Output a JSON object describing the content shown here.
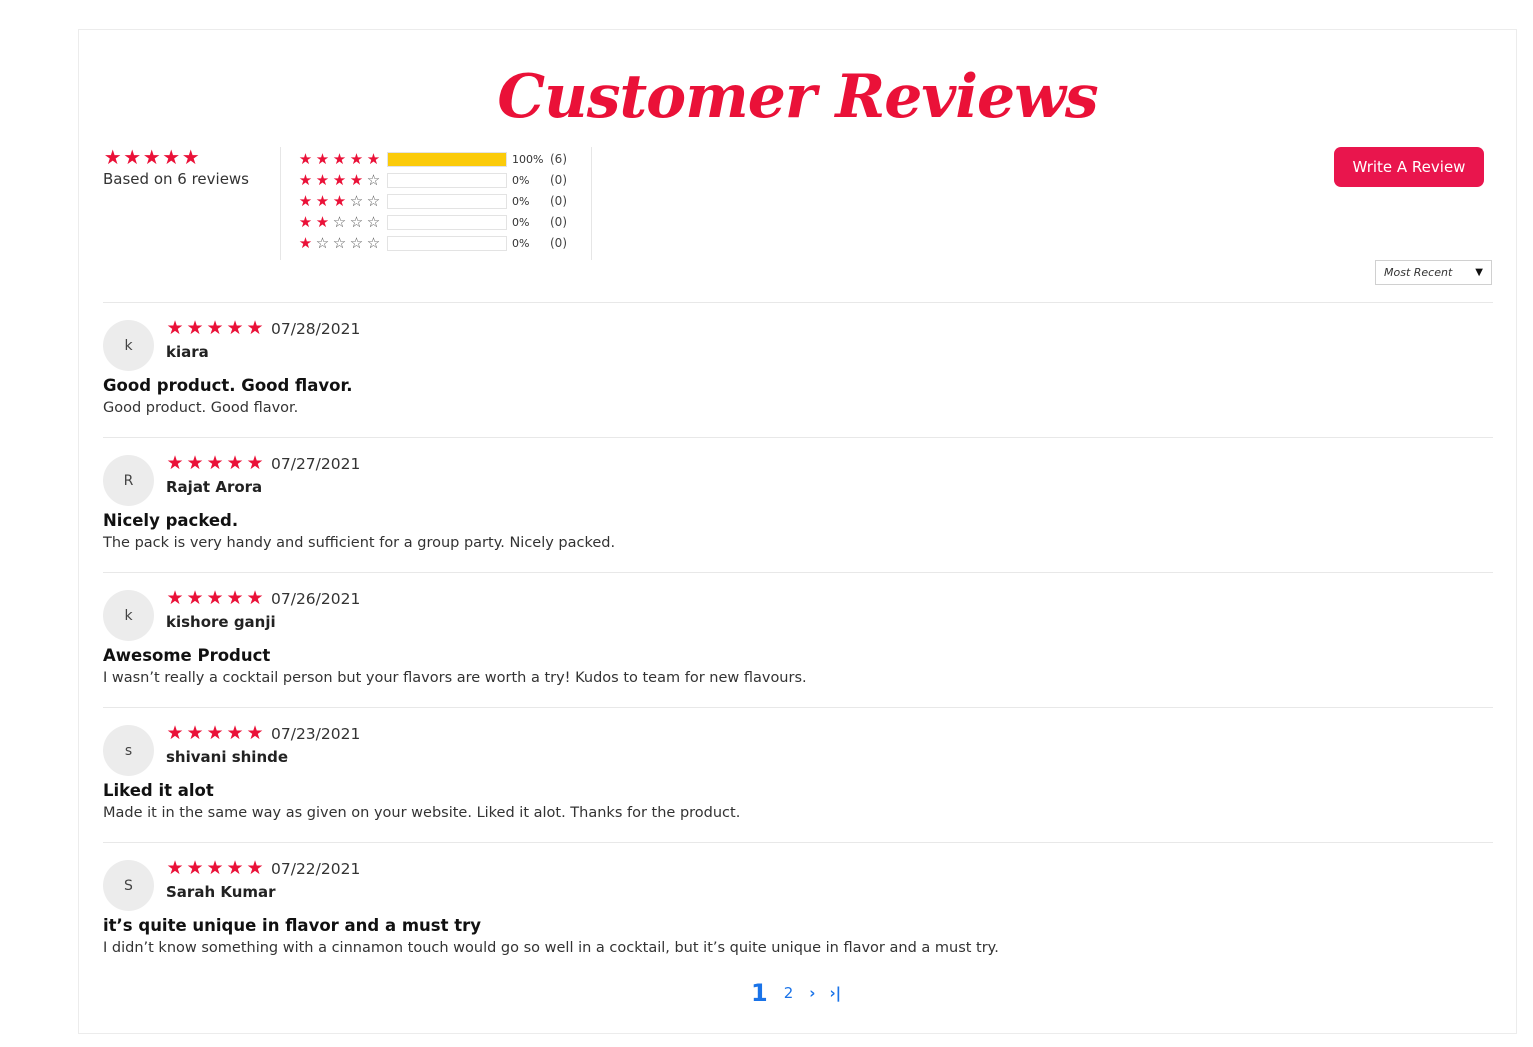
{
  "header": {
    "title": "Customer Reviews"
  },
  "summary": {
    "rating": 5,
    "based_on": "Based on 6 reviews",
    "star_icon": "star-icon"
  },
  "histogram": [
    {
      "stars": 5,
      "percent_label": "100%",
      "count_label": "(6)",
      "fill": 1.0
    },
    {
      "stars": 4,
      "percent_label": "0%",
      "count_label": "(0)",
      "fill": 0
    },
    {
      "stars": 3,
      "percent_label": "0%",
      "count_label": "(0)",
      "fill": 0
    },
    {
      "stars": 2,
      "percent_label": "0%",
      "count_label": "(0)",
      "fill": 0
    },
    {
      "stars": 1,
      "percent_label": "0%",
      "count_label": "(0)",
      "fill": 0
    }
  ],
  "actions": {
    "write_review_label": "Write A Review",
    "sort_selected": "Most Recent"
  },
  "reviews": [
    {
      "initial": "k",
      "rating": 5,
      "date": "07/28/2021",
      "author": "kiara",
      "title": "Good product. Good flavor.",
      "body": "Good product. Good flavor."
    },
    {
      "initial": "R",
      "rating": 5,
      "date": "07/27/2021",
      "author": "Rajat Arora",
      "title": "Nicely packed.",
      "body": "The pack is very handy and sufficient for a group party. Nicely packed."
    },
    {
      "initial": "k",
      "rating": 5,
      "date": "07/26/2021",
      "author": "kishore ganji",
      "title": "Awesome Product",
      "body": "I wasn’t really a cocktail person but your flavors are worth a try! Kudos to team for new flavours."
    },
    {
      "initial": "s",
      "rating": 5,
      "date": "07/23/2021",
      "author": "shivani shinde",
      "title": "Liked it alot",
      "body": "Made it in the same way as given on your website. Liked it alot. Thanks for the product."
    },
    {
      "initial": "S",
      "rating": 5,
      "date": "07/22/2021",
      "author": "Sarah Kumar",
      "title": "it’s quite unique in flavor and a must try",
      "body": "I didn’t know something with a cinnamon touch would go so well in a cocktail, but it’s quite unique in flavor and a must try."
    }
  ],
  "pagination": {
    "current": "1",
    "next_page": "2",
    "next_icon": "chevron-right-icon",
    "last_icon": "chevron-last-icon"
  },
  "colors": {
    "accent": "#ea1138",
    "button": "#e9154d",
    "bar_fill": "#fbcb0a",
    "link": "#1a73e8"
  }
}
